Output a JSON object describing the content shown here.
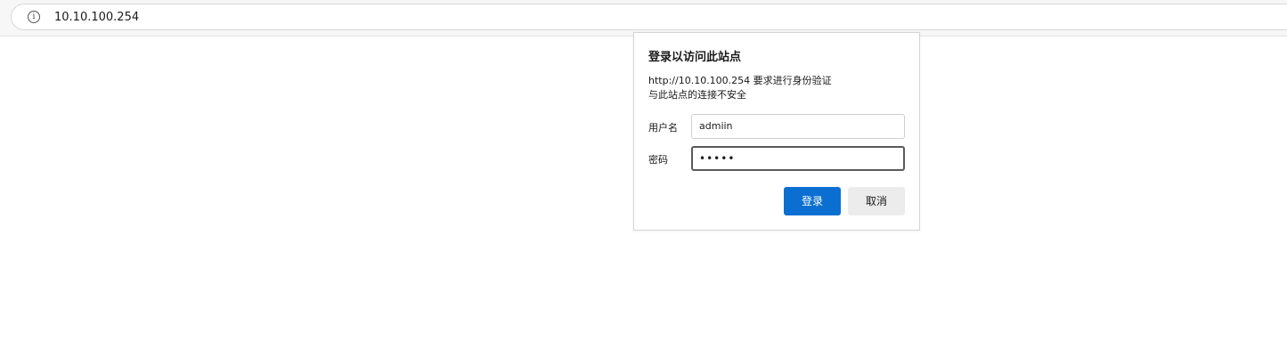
{
  "browser": {
    "url": "10.10.100.254",
    "info_icon": "info-icon",
    "info_glyph": "i"
  },
  "auth_dialog": {
    "title": "登录以访问此站点",
    "message_line1": "http://10.10.100.254 要求进行身份验证",
    "message_line2": "与此站点的连接不安全",
    "username_label": "用户名",
    "username_value": "admiin",
    "password_label": "密码",
    "password_masked": "•••••",
    "login_label": "登录",
    "cancel_label": "取消",
    "accent_color": "#0a6fd1"
  }
}
